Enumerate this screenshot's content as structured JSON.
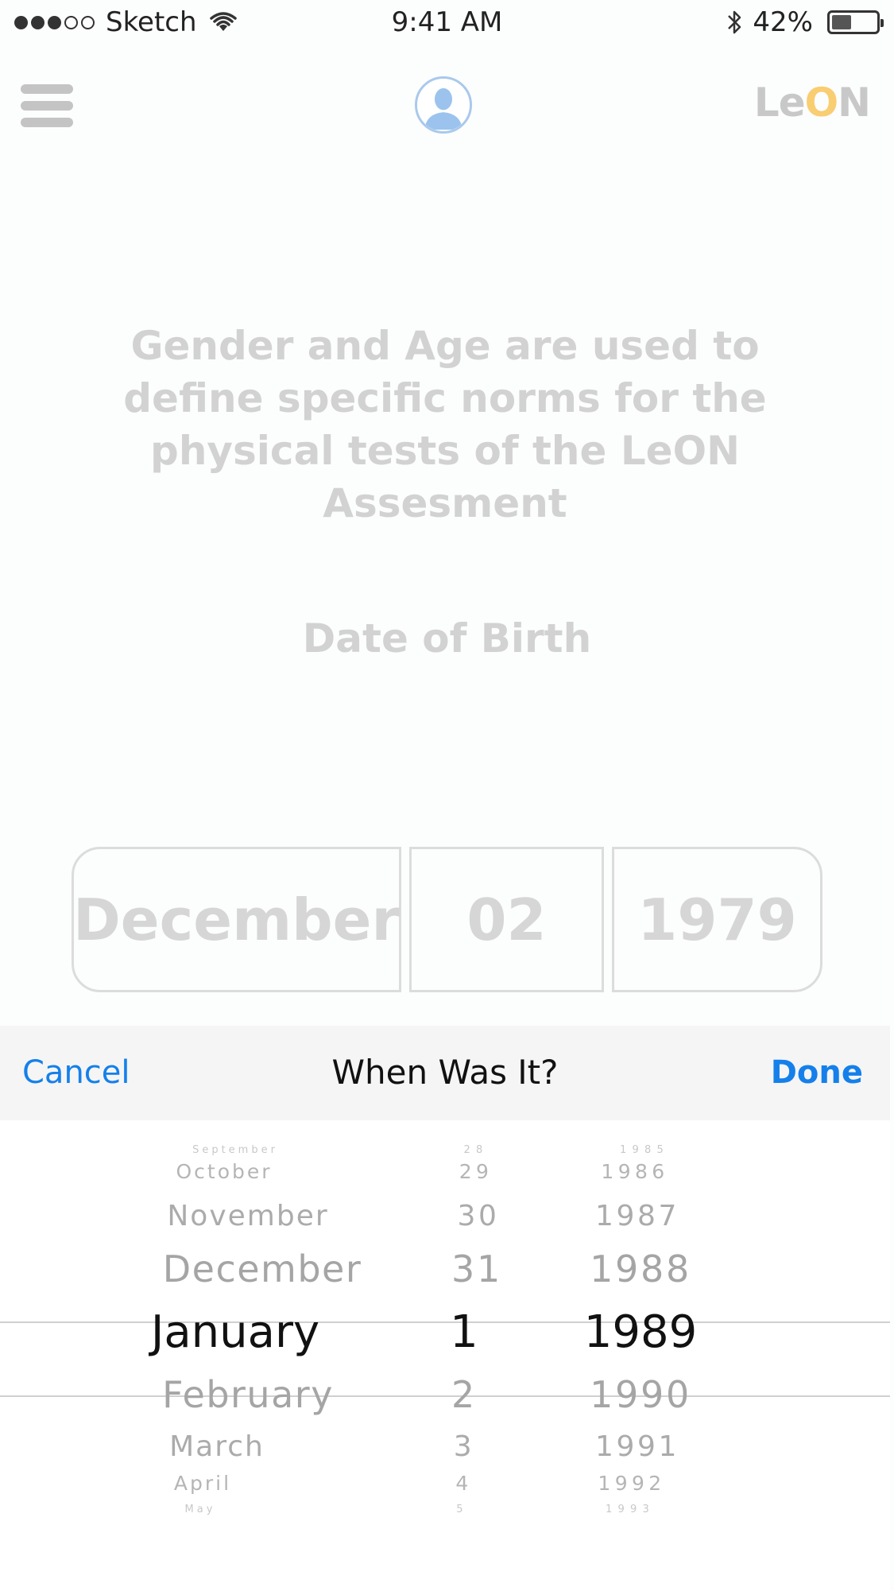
{
  "status_bar": {
    "carrier": "Sketch",
    "time": "9:41 AM",
    "battery": "42%"
  },
  "nav": {
    "logo_prefix": "Le",
    "logo_o": "O",
    "logo_suffix": "N",
    "logo_accent_color": "#f9cd71"
  },
  "content": {
    "info_line1": "Gender and Age are used to",
    "info_line2": "define specific norms for the",
    "info_line3": "physical tests of the LeON",
    "info_line4": "Assesment",
    "dob_label": "Date of Birth",
    "month_value": "December",
    "day_value": "02",
    "year_value": "1979"
  },
  "picker": {
    "cancel_label": "Cancel",
    "title": "When Was It?",
    "done_label": "Done",
    "accent_color": "#1580ea",
    "months": [
      "September",
      "October",
      "November",
      "December",
      "January",
      "February",
      "March",
      "April",
      "May"
    ],
    "days": [
      "28",
      "29",
      "30",
      "31",
      "1",
      "2",
      "3",
      "4",
      "5"
    ],
    "years": [
      "1985",
      "1986",
      "1987",
      "1988",
      "1989",
      "1990",
      "1991",
      "1992",
      "1993"
    ],
    "selected_month": "January",
    "selected_day": "1",
    "selected_year": "1989"
  }
}
